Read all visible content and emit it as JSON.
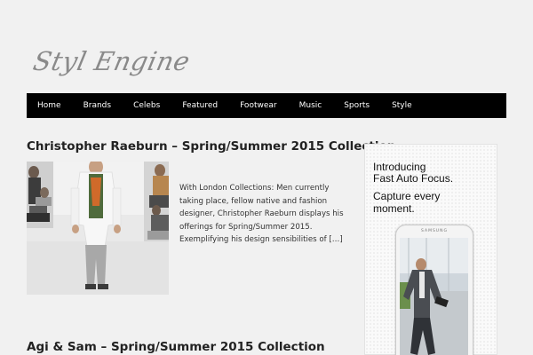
{
  "site": {
    "logo_text": "Styl Engine"
  },
  "nav": {
    "items": [
      {
        "label": "Home"
      },
      {
        "label": "Brands"
      },
      {
        "label": "Celebs"
      },
      {
        "label": "Featured"
      },
      {
        "label": "Footwear"
      },
      {
        "label": "Music"
      },
      {
        "label": "Sports"
      },
      {
        "label": "Style"
      }
    ]
  },
  "posts": [
    {
      "title": "Christopher Raeburn – Spring/Summer 2015 Collection",
      "excerpt": "With London Collections: Men currently taking place, fellow native and fashion designer, Christopher Raeburn displays his offerings for Spring/Summer 2015. Exemplifying his design sensibilities of […]"
    },
    {
      "title": "Agi & Sam – Spring/Summer 2015 Collection"
    }
  ],
  "ad": {
    "headline_line1": "Introducing",
    "headline_line2": "Fast Auto Focus.",
    "sub_line1": "Capture every",
    "sub_line2": "moment.",
    "phone_brand": "SAMSUNG"
  },
  "colors": {
    "page_bg": "#f1f1f1",
    "nav_bg": "#000000",
    "nav_text": "#ffffff",
    "logo": "#8a8a8a"
  }
}
